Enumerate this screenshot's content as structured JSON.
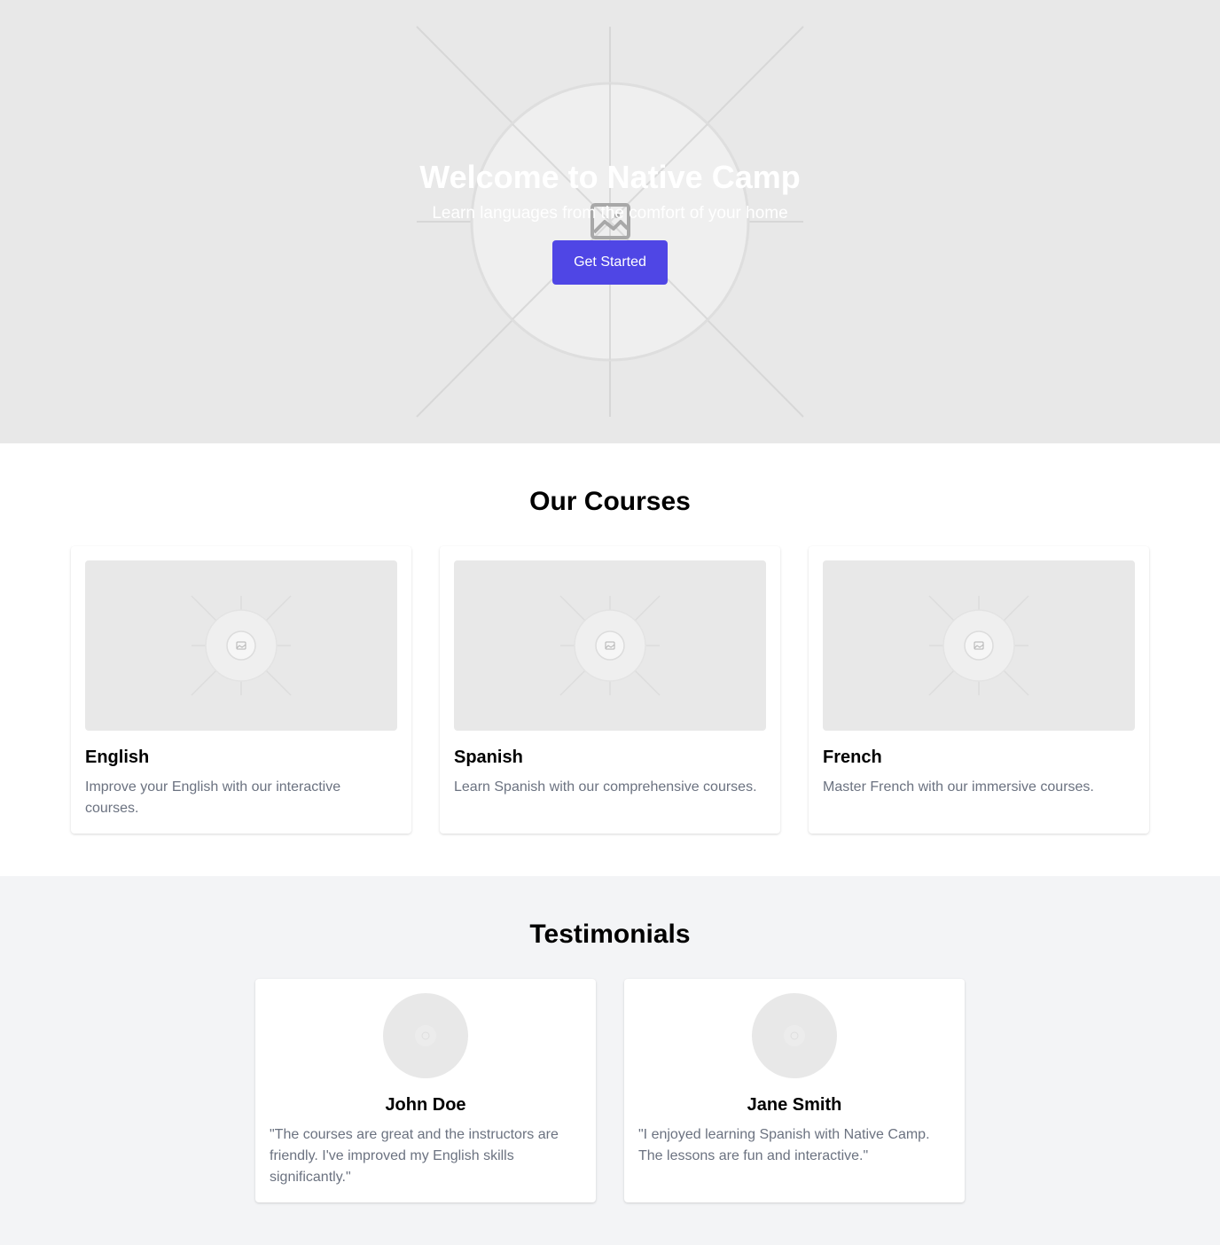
{
  "hero": {
    "title": "Welcome to Native Camp",
    "subtitle": "Learn languages from the comfort of your home",
    "cta_label": "Get Started",
    "background_icon": "image-placeholder-icon"
  },
  "courses": {
    "heading": "Our Courses",
    "items": [
      {
        "name": "English",
        "description": "Improve your English with our interactive courses.",
        "image_icon": "image-placeholder-icon"
      },
      {
        "name": "Spanish",
        "description": "Learn Spanish with our comprehensive courses.",
        "image_icon": "image-placeholder-icon"
      },
      {
        "name": "French",
        "description": "Master French with our immersive courses.",
        "image_icon": "image-placeholder-icon"
      }
    ]
  },
  "testimonials": {
    "heading": "Testimonials",
    "items": [
      {
        "name": "John Doe",
        "quote": "\"The courses are great and the instructors are friendly. I've improved my English skills significantly.\"",
        "avatar_icon": "avatar-placeholder-icon"
      },
      {
        "name": "Jane Smith",
        "quote": "\"I enjoyed learning Spanish with Native Camp. The lessons are fun and interactive.\"",
        "avatar_icon": "avatar-placeholder-icon"
      }
    ]
  },
  "colors": {
    "accent": "#4f46e5",
    "placeholder_bg": "#e8e8e8",
    "muted_text": "#6b7280",
    "section_bg": "#f3f4f6"
  }
}
